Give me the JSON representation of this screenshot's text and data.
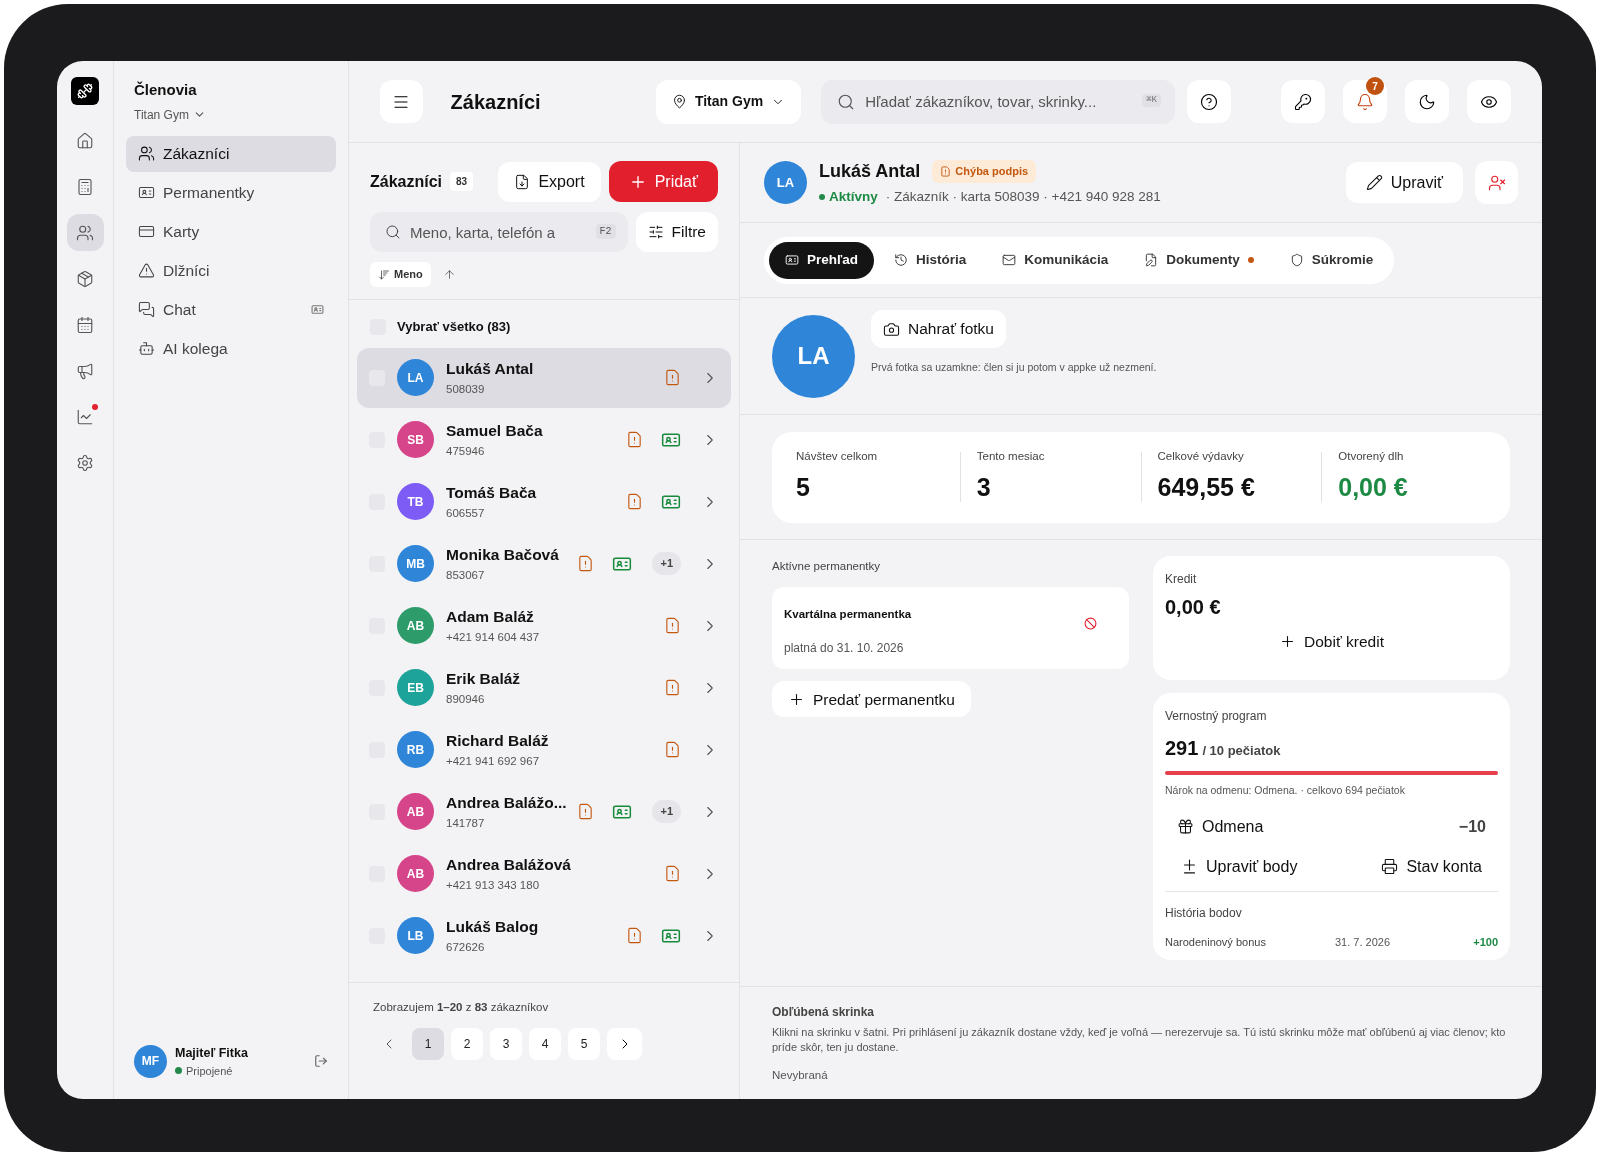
{
  "rail": {
    "items": [
      {
        "selected": false,
        "dot": false
      },
      {
        "selected": false,
        "dot": false
      },
      {
        "selected": true,
        "dot": false
      },
      {
        "selected": false,
        "dot": false
      },
      {
        "selected": false,
        "dot": false
      },
      {
        "selected": false,
        "dot": false
      },
      {
        "selected": false,
        "dot": true
      },
      {
        "selected": false,
        "dot": false
      }
    ]
  },
  "sidebar": {
    "title": "Členovia",
    "gym": "Titan Gym",
    "items": [
      {
        "label": "Zákazníci",
        "selected": true
      },
      {
        "label": "Permanentky",
        "selected": false
      },
      {
        "label": "Karty",
        "selected": false
      },
      {
        "label": "Dlžníci",
        "selected": false
      },
      {
        "label": "Chat",
        "selected": false
      },
      {
        "label": "AI kolega",
        "selected": false
      }
    ],
    "user": {
      "initials": "MF",
      "name": "Majiteľ Fitka",
      "status": "Pripojené",
      "online": true
    }
  },
  "topbar": {
    "title": "Zákazníci",
    "location": "Titan Gym",
    "search_placeholder": "Hľadať zákazníkov, tovar, skrinky...",
    "shortcut": "⌘K",
    "notifications": "7"
  },
  "list": {
    "title": "Zákazníci",
    "count": "83",
    "export": "Export",
    "add": "Pridať",
    "search_placeholder": "Meno, karta, telefón a",
    "search_key": "F2",
    "filter": "Filtre",
    "sort": "Meno",
    "select_all": {
      "label": "Vybrať všetko (83)",
      "checked": false
    },
    "rows": [
      {
        "initials": "LA",
        "color": "#2f86d9",
        "name": "Lukáš Antal",
        "sub": "508039",
        "card": false,
        "extra": "",
        "checked": false,
        "selected": true
      },
      {
        "initials": "SB",
        "color": "#d6448a",
        "name": "Samuel Bača",
        "sub": "475946",
        "card": true,
        "extra": "",
        "checked": false,
        "selected": false
      },
      {
        "initials": "TB",
        "color": "#7c5cf5",
        "name": "Tomáš Bača",
        "sub": "606557",
        "card": true,
        "extra": "",
        "checked": false,
        "selected": false
      },
      {
        "initials": "MB",
        "color": "#2f86d9",
        "name": "Monika Bačová",
        "sub": "853067",
        "card": true,
        "extra": "+1",
        "checked": false,
        "selected": false
      },
      {
        "initials": "AB",
        "color": "#2e9c6a",
        "name": "Adam Baláž",
        "sub": "+421 914 604 437",
        "card": false,
        "extra": "",
        "checked": false,
        "selected": false
      },
      {
        "initials": "EB",
        "color": "#1ea39a",
        "name": "Erik Baláž",
        "sub": "890946",
        "card": false,
        "extra": "",
        "checked": false,
        "selected": false
      },
      {
        "initials": "RB",
        "color": "#2f86d9",
        "name": "Richard Baláž",
        "sub": "+421 941 692 967",
        "card": false,
        "extra": "",
        "checked": false,
        "selected": false
      },
      {
        "initials": "AB",
        "color": "#d6448a",
        "name": "Andrea Balážo...",
        "sub": "141787",
        "card": true,
        "extra": "+1",
        "checked": false,
        "selected": false
      },
      {
        "initials": "AB",
        "color": "#d6448a",
        "name": "Andrea Balážová",
        "sub": "+421 913 343 180",
        "card": false,
        "extra": "",
        "checked": false,
        "selected": false
      },
      {
        "initials": "LB",
        "color": "#2f86d9",
        "name": "Lukáš Balog",
        "sub": "672626",
        "card": true,
        "extra": "",
        "checked": false,
        "selected": false
      }
    ],
    "footer": "Zobrazujem **1–20** z **83** zákazníkov",
    "pages": [
      {
        "label": "1",
        "selected": true
      },
      {
        "label": "2",
        "selected": false
      },
      {
        "label": "3",
        "selected": false
      },
      {
        "label": "4",
        "selected": false
      },
      {
        "label": "5",
        "selected": false
      }
    ]
  },
  "detail": {
    "initials": "LA",
    "name": "Lukáš Antal",
    "badge": "Chýba podpis",
    "status": "Aktívny",
    "active": true,
    "meta": "· Zákazník · karta 508039 · +421 940 928 281",
    "edit": "Upraviť",
    "tabs": [
      {
        "label": "Prehľad",
        "selected": true,
        "dot": false
      },
      {
        "label": "História",
        "selected": false,
        "dot": false
      },
      {
        "label": "Komunikácia",
        "selected": false,
        "dot": false
      },
      {
        "label": "Dokumenty",
        "selected": false,
        "dot": true
      },
      {
        "label": "Súkromie",
        "selected": false,
        "dot": false
      }
    ],
    "photo_initials": "LA",
    "photo_button": "Nahrať fotku",
    "photo_note": "Prvá fotka sa uzamkne: člen si ju potom v appke už nezmení.",
    "stats": [
      {
        "label": "Návštev celkom",
        "value": "5",
        "positive": false
      },
      {
        "label": "Tento mesiac",
        "value": "3",
        "positive": false
      },
      {
        "label": "Celkové výdavky",
        "value": "649,55 €",
        "positive": false
      },
      {
        "label": "Otvorený dlh",
        "value": "0,00 €",
        "positive": true
      }
    ],
    "passes": {
      "title": "Aktívne permanentky",
      "items": [
        {
          "name": "Kvartálna permanentka",
          "valid": "platná do 31. 10. 2026"
        }
      ],
      "sell": "Predať permanentku"
    },
    "credit": {
      "title": "Kredit",
      "value": "0,00 €",
      "topup": "Dobiť kredit"
    },
    "loyalty": {
      "title": "Vernostný program",
      "points": "291",
      "goal": "/ 10 pečiatok",
      "level": 1,
      "note": "Nárok na odmenu: Odmena. · celkovo 694 pečiatok",
      "reward": "Odmena",
      "reward_cost": "−10",
      "adjust": "Upraviť body",
      "statement": "Stav konta",
      "history_title": "História bodov",
      "history": [
        {
          "label": "Narodeninový bonus",
          "date": "31. 7. 2026",
          "points": "+100"
        }
      ]
    },
    "locker": {
      "title": "Obľúbená skrinka",
      "text": "Klikni na skrinku v šatni. Pri prihlásení ju zákazník dostane vždy, keď je voľná — nerezervuje sa. Tú istú skrinku môže mať obľúbenú aj viac členov; kto príde skôr, ten ju dostane.",
      "value": "Nevybraná"
    }
  }
}
